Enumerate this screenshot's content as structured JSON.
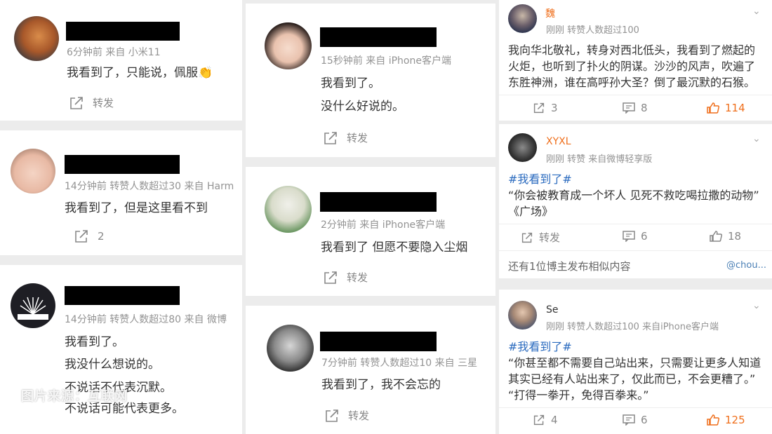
{
  "watermark": "图片来源：互联网",
  "colors": {
    "accent_orange": "#ef6f1c",
    "link_blue": "#2b6bbf",
    "meta_gray": "#939393"
  },
  "col1": [
    {
      "meta": "6分钟前  来自 小米11",
      "lines": [
        "我看到了，只能说，佩服👏"
      ],
      "action": {
        "icon": "repost-icon",
        "label": "转发"
      }
    },
    {
      "meta": "14分钟前  转赞人数超过30  来自 Harm",
      "lines": [
        "我看到了，但是这里看不到"
      ],
      "action": {
        "icon": "repost-icon",
        "label": "2"
      }
    },
    {
      "meta": "14分钟前  转赞人数超过80  来自 微博",
      "lines": [
        "我看到了。",
        "我没什么想说的。",
        "不说话不代表沉默。",
        "不说话可能代表更多。"
      ]
    }
  ],
  "col2": [
    {
      "meta": "15秒钟前  来自 iPhone客户端",
      "lines": [
        "我看到了。",
        "没什么好说的。"
      ],
      "action": {
        "icon": "repost-icon",
        "label": "转发"
      }
    },
    {
      "meta": "2分钟前  来自 iPhone客户端",
      "lines": [
        "我看到了 但愿不要隐入尘烟"
      ],
      "action": {
        "icon": "repost-icon",
        "label": "转发"
      }
    },
    {
      "meta": "7分钟前  转赞人数超过10  来自 三星",
      "lines": [
        "我看到了，我不会忘的"
      ],
      "action": {
        "icon": "repost-icon",
        "label": "转发"
      }
    }
  ],
  "col3": {
    "post1": {
      "username": "魏",
      "meta": "刚刚  转赞人数超过100",
      "lines": [
        "我向华北敬礼，转身对西北低头，我看到了燃起的",
        "火炬，也听到了扑火的阴谋。沙沙的风声，吹遍了",
        "东胜神洲，谁在高呼孙大圣？倒了最沉默的石猴。"
      ],
      "reposts": "3",
      "comments": "8",
      "likes": "114"
    },
    "post2": {
      "username": "XYXL",
      "meta": "刚刚  转赞  来自微博轻享版",
      "hashtag": "#我看到了#",
      "lines": [
        "“你会被教育成一个坏人 见死不救吃喝拉撒的动物”",
        "《广场》"
      ],
      "reposts": "转发",
      "comments": "6",
      "likes": "18",
      "similar": "还有1位博主发布相似内容",
      "mention": "@chou..."
    },
    "post3": {
      "username": "Se",
      "meta": "刚刚  转赞人数超过100  来自iPhone客户端",
      "hashtag": "#我看到了#",
      "lines": [
        "“你甚至都不需要自己站出来，只需要让更多人知道",
        "其实已经有人站出来了，仅此而已，不会更糟了。”",
        "“打得一拳开，免得百拳来。”"
      ],
      "reposts": "4",
      "comments": "6",
      "likes": "125"
    }
  }
}
